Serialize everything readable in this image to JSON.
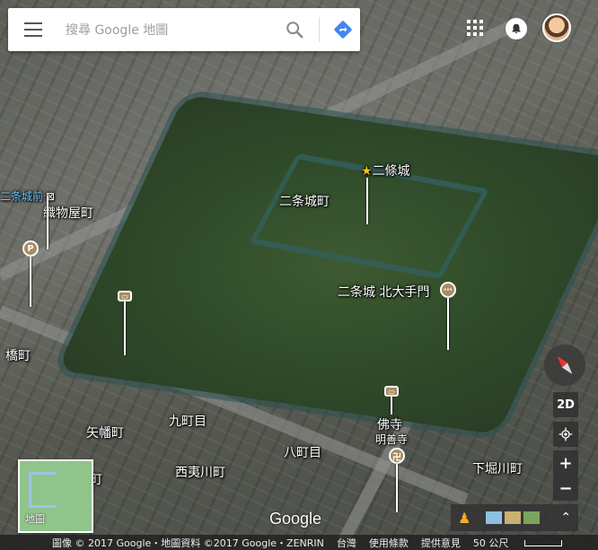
{
  "search": {
    "placeholder": "搜尋 Google 地圖"
  },
  "map_labels": {
    "nijo_castle": "二條城",
    "nijojo_cho": "二条城町",
    "kitaotemon": "二条城 北大手門",
    "nijojo_mae": "二条城前",
    "orimonoya_cho": "織物屋町",
    "bashi_cho": "橋町",
    "yawata_cho": "矢幡町",
    "kyuu_chome": "九町目",
    "nishiebisugawa_cho": "西夷川町",
    "hatchome": "八町目",
    "butsu_ji": "佛寺",
    "myozen_ji": "明善寺",
    "shimohorikawa_cho": "下堀川町",
    "left_cho": "町"
  },
  "controls": {
    "mode_2d": "2D",
    "zoom_in": "+",
    "zoom_out": "−",
    "minimap_label": "地圖"
  },
  "brand": {
    "logo": "Google"
  },
  "footer": {
    "copyright": "圖像 © 2017 Google・地圖資料 ©2017 Google・ZENRIN",
    "region": "台灣",
    "terms": "使用條款",
    "feedback": "提供意見",
    "scale": "50 公尺"
  },
  "colors": {
    "accent_blue": "#4285f4",
    "poi_brown": "#a88c63",
    "water": "#6cc6ff"
  }
}
